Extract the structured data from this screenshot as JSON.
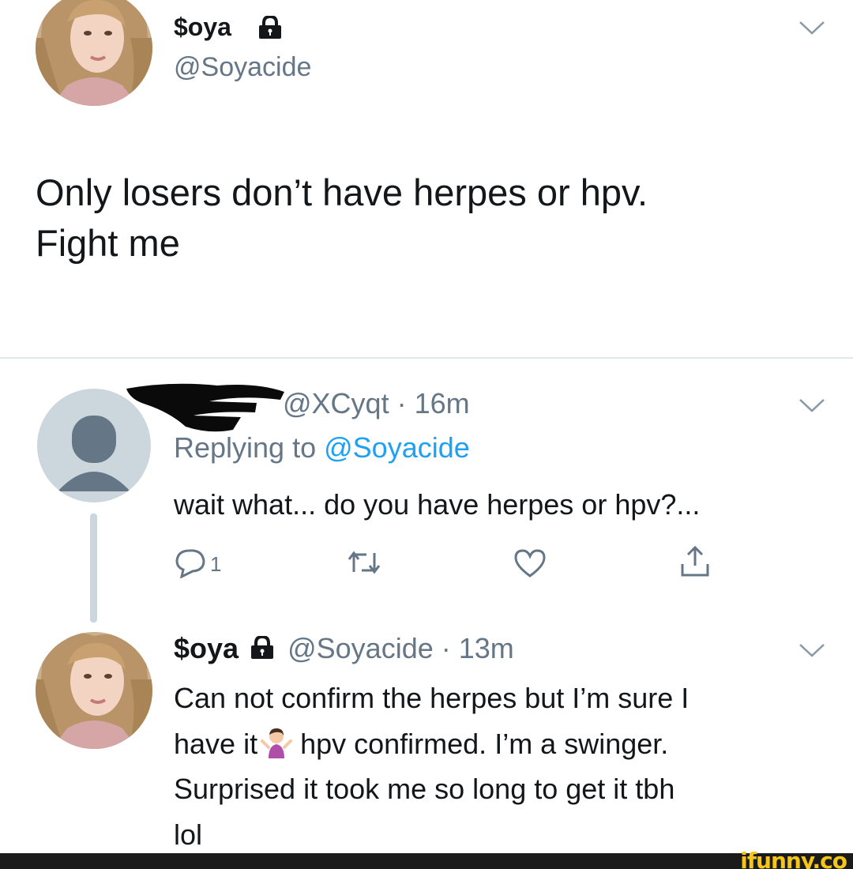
{
  "tweet": {
    "author_name": "$oya",
    "author_handle": "@Soyacide",
    "text_line1": "Only losers don’t have herpes or hpv.",
    "text_line2": "Fight me"
  },
  "reply": {
    "meta": "@XCyqt · 16m",
    "replying_prefix": "Replying to ",
    "replying_mention": "@Soyacide",
    "text": "wait what... do you have herpes or hpv?...",
    "actions": {
      "reply_count": "1",
      "reply_icon": "comment-icon",
      "retweet_icon": "retweet-icon",
      "like_icon": "heart-icon",
      "share_icon": "share-icon"
    }
  },
  "reply2": {
    "author_name": "$oya",
    "meta": "@Soyacide · 13m",
    "line1": "Can not confirm the herpes but I’m sure I",
    "line2_a": "have it",
    "line2_b": "hpv confirmed. I’m a swinger.",
    "line3": "Surprised it took me so long to get it tbh",
    "line4": "lol",
    "emoji": "woman-shrugging-emoji"
  },
  "watermark": "ifunny.co",
  "colors": {
    "text": "#14171a",
    "secondary": "#657786",
    "link": "#1da1f2",
    "line": "#ccd6dd"
  }
}
